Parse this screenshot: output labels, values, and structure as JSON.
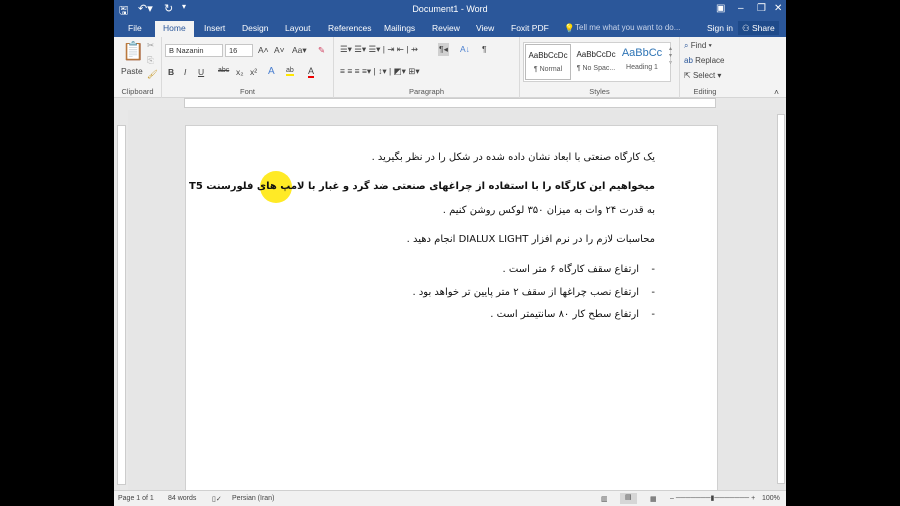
{
  "window": {
    "title": "Document1 - Word"
  },
  "tabs": [
    "File",
    "Home",
    "Insert",
    "Design",
    "Layout",
    "References",
    "Mailings",
    "Review",
    "View",
    "Foxit PDF"
  ],
  "tell_me": "Tell me what you want to do...",
  "sign_in": "Sign in",
  "share": "Share",
  "clipboard": {
    "paste": "Paste",
    "label": "Clipboard"
  },
  "font": {
    "name": "B Nazanin",
    "size": "16",
    "label": "Font",
    "buttons": [
      "B",
      "I",
      "U",
      "abc",
      "x₂",
      "x²",
      "A",
      "ab",
      "A"
    ]
  },
  "paragraph": {
    "label": "Paragraph"
  },
  "styles": {
    "label": "Styles",
    "items": [
      {
        "preview": "AaBbCcDc",
        "name": "¶ Normal"
      },
      {
        "preview": "AaBbCcDc",
        "name": "¶ No Spac..."
      },
      {
        "preview": "AaBbCc",
        "name": "Heading 1"
      }
    ]
  },
  "editing": {
    "label": "Editing",
    "find": "Find",
    "replace": "Replace",
    "select": "Select"
  },
  "document": {
    "lines": [
      "یک کارگاه صنعتی با ابعاد نشان داده شده در شکل را در نظر بگیرید .",
      "میخواهیم این کارگاه را با استفاده از چراغهای صنعتی ضد گرد و غبار با لامپ های فلورسنت T5",
      "به قدرت ۲۴ وات به میزان ۳۵۰ لوکس روشن کنیم .",
      "محاسبات لازم را در نرم افزار  DIALUX LIGHT انجام دهید ."
    ],
    "bullets": [
      "ارتفاع سقف کارگاه ۶ متر است .",
      "ارتفاع نصب چراغها از سقف ۲ متر پایین تر خواهد بود .",
      "ارتفاع سطح کار ۸۰ سانتیمتر است ."
    ]
  },
  "status": {
    "page": "Page 1 of 1",
    "words": "84 words",
    "language": "Persian (Iran)",
    "zoom": "100%"
  }
}
